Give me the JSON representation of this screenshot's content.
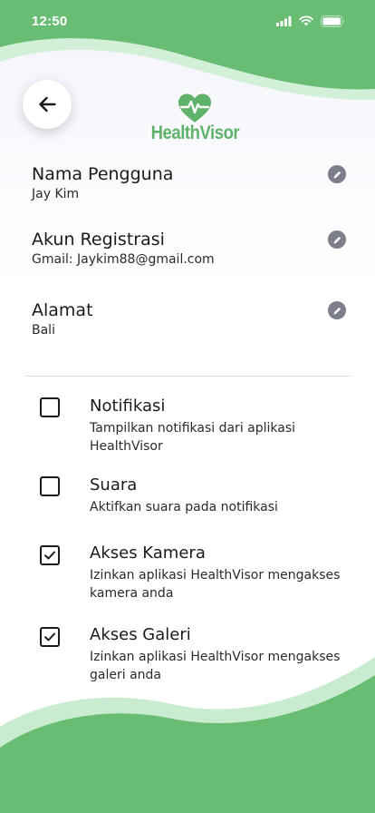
{
  "status_bar": {
    "time": "12:50",
    "icons": [
      "signal-icon",
      "wifi-icon",
      "battery-icon"
    ]
  },
  "header": {
    "back_icon": "arrow-left-icon",
    "logo_text": "HealthVisor"
  },
  "profile": {
    "fields": [
      {
        "label": "Nama Pengguna",
        "value": "Jay Kim",
        "action_icon": "pencil-icon"
      },
      {
        "label": "Akun Registrasi",
        "value": "Gmail: Jaykim88@gmail.com",
        "action_icon": "pencil-icon"
      },
      {
        "label": "Alamat",
        "value": "Bali",
        "action_icon": "pencil-icon"
      }
    ]
  },
  "settings": {
    "items": [
      {
        "title": "Notifikasi",
        "description": "Tampilkan notifikasi dari aplikasi HealthVisor",
        "checked": false
      },
      {
        "title": "Suara",
        "description": "Aktifkan suara pada notifikasi",
        "checked": false
      },
      {
        "title": "Akses Kamera",
        "description": "Izinkan aplikasi HealthVisor mengakses kamera anda",
        "checked": true
      },
      {
        "title": "Akses Galeri",
        "description": "Izinkan aplikasi HealthVisor mengakses galeri anda",
        "checked": true
      }
    ]
  },
  "colors": {
    "accent_green": "#5fb26a",
    "light_green": "#c8ecd0",
    "edit_icon_bg": "#7c7f8a"
  }
}
